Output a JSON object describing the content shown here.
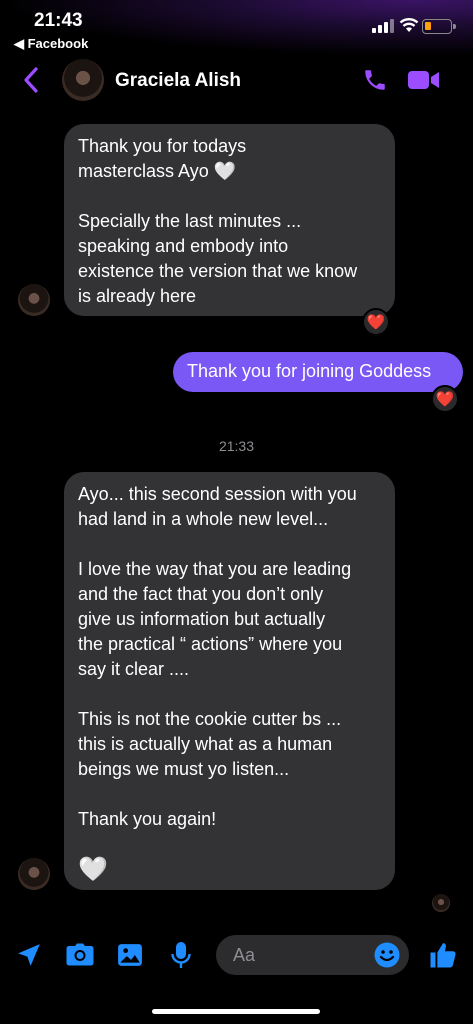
{
  "status_bar": {
    "time": "21:43",
    "back_app": "◀ Facebook"
  },
  "header": {
    "contact_name": "Graciela Alish"
  },
  "messages": {
    "m1_lines": [
      "Thank you for todays",
      "masterclass Ayo 🤍",
      "",
      "Specially the last minutes ...",
      "speaking and embody into",
      "existence the version that we know",
      "is already here"
    ],
    "m1_reaction": "❤️",
    "m2_text": "Thank you for joining Goddess",
    "m2_reaction": "❤️",
    "timestamp": "21:33",
    "m3_lines": [
      "Ayo... this second session with you",
      "had land in a whole new level...",
      "",
      "I love the way that you are leading",
      "and the fact that you don’t only",
      "give us information but actually",
      "the practical “ actions” where you",
      "say it clear ....",
      "",
      "This is not the cookie cutter bs ...",
      "this is actually what as a human",
      "beings we must yo listen...",
      "",
      "Thank you again!",
      "",
      "🤍"
    ]
  },
  "composer": {
    "placeholder": "Aa"
  },
  "colors": {
    "accent": "#7a58f5",
    "header_icons": "#9b4dff",
    "toolbar_icons": "#1f8cff",
    "incoming_bubble": "#333336"
  }
}
